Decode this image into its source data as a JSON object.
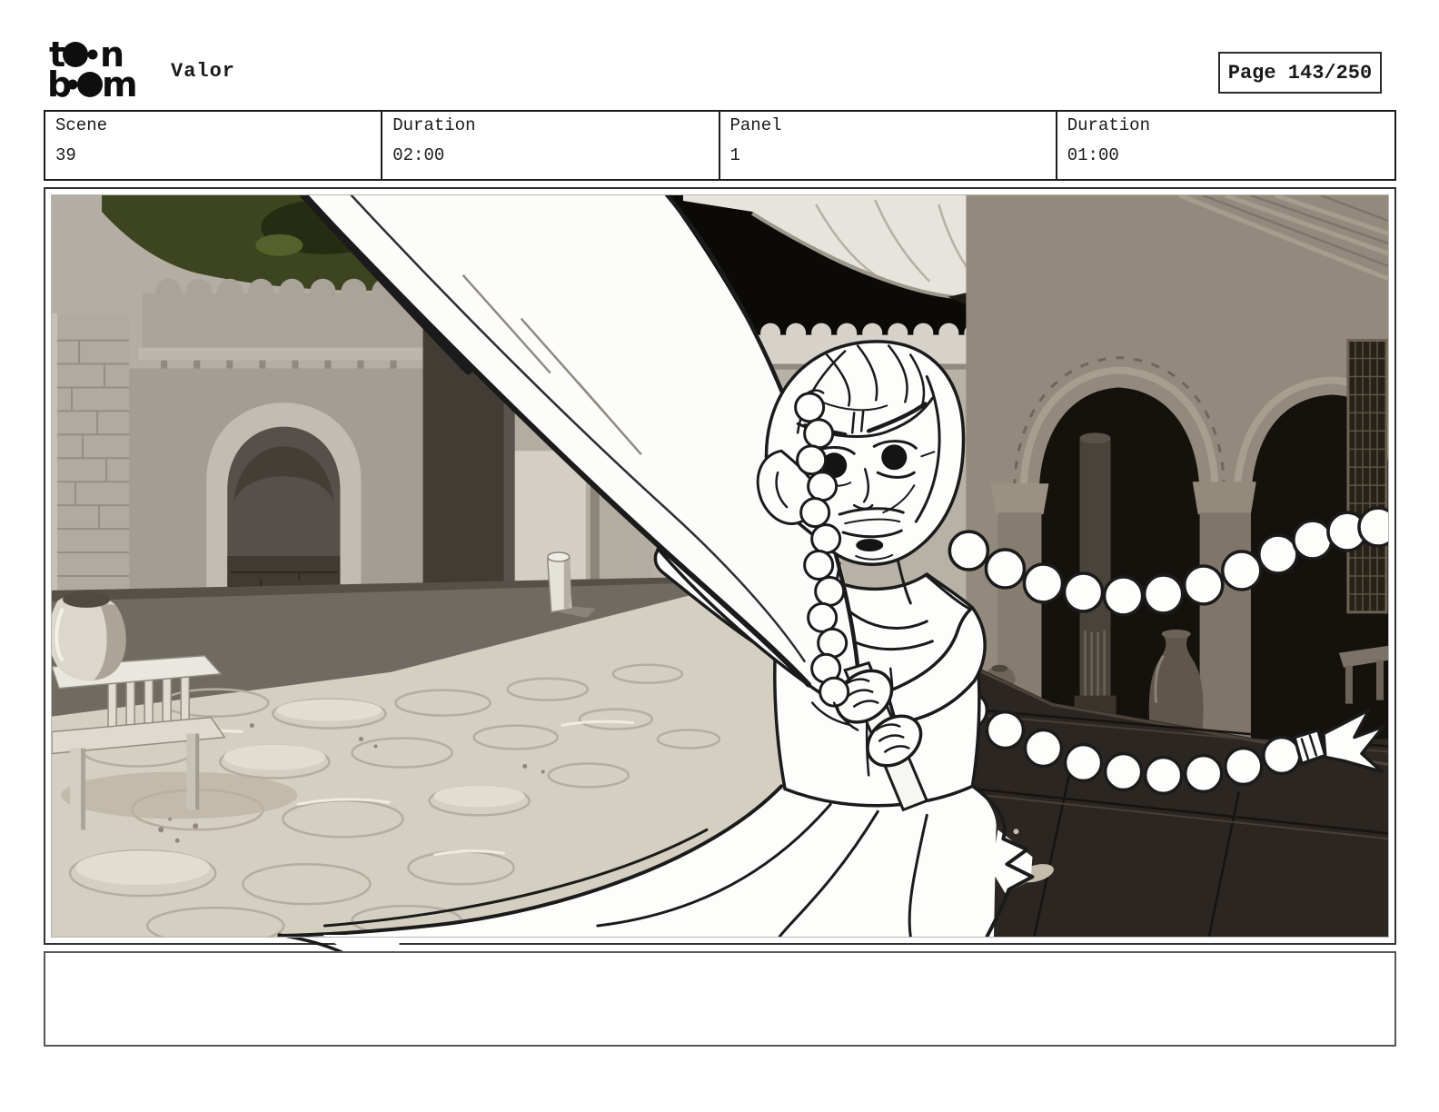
{
  "header": {
    "logo": {
      "alt": "toon boom",
      "l1a": "t",
      "l1b": "n",
      "l2a": "b",
      "l2b": "m"
    },
    "title": "Valor",
    "page_label": "Page 143/250"
  },
  "info_table": {
    "cells": [
      {
        "label": "Scene",
        "value": "39"
      },
      {
        "label": "Duration",
        "value": "02:00"
      },
      {
        "label": "Panel",
        "value": "1"
      },
      {
        "label": "Duration",
        "value": "01:00"
      }
    ]
  },
  "storyboard_panel": {
    "description": "Hand-drawn girl with a long whipping braid gripping a large foreshortened sword, composited over a grayscale 3D blockout of a Moroccan courtyard with keyhole arches, crenellated walls, an arcade, a bench and flagstone ground"
  },
  "caption": {
    "text": ""
  },
  "colors": {
    "ink": "#1b1b1b",
    "paper": "#ffffff",
    "table_border": "#1c1c1c",
    "panel_border": "#333333",
    "caption_border": "#585858",
    "sunlit_floor": "#d5cfc1",
    "shadow_floor": "#6f6a62",
    "dark_tiles": "#2b2622",
    "wall_light": "#c2bcb2",
    "wall_dark": "#938a7d",
    "foliage": "#3c4420",
    "black_opening": "#0b0a07"
  }
}
